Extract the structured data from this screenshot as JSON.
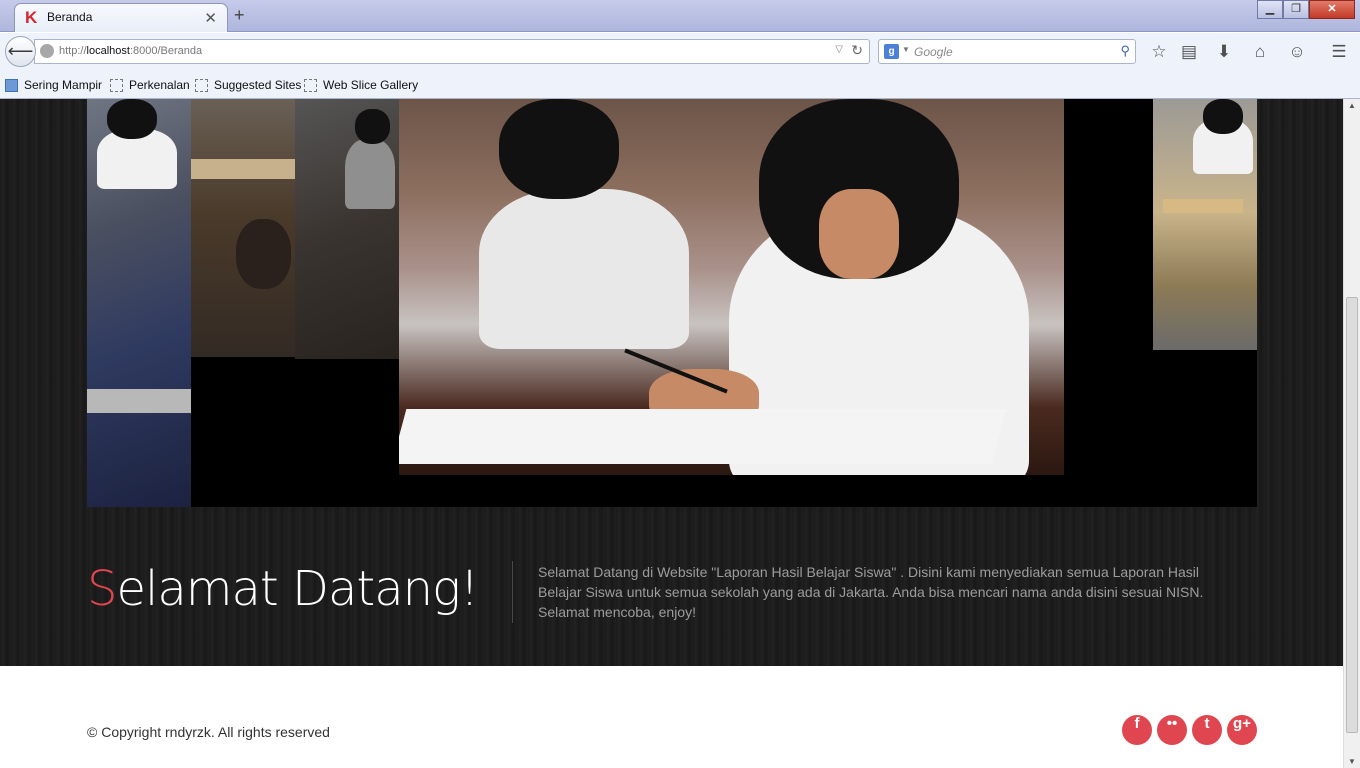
{
  "browser": {
    "tab_title": "Beranda",
    "tab_favicon": "K",
    "new_tab_symbol": "+",
    "url_scheme": "http://",
    "url_host": "localhost",
    "url_path": ":8000/Beranda",
    "search_placeholder": "Google",
    "search_engine_glyph": "g",
    "bookmarks": [
      "Sering Mampir",
      "Perkenalan",
      "Suggested Sites",
      "Web Slice Gallery"
    ]
  },
  "hero": {
    "title_first_letter": "S",
    "title_rest": "elamat Datang!",
    "intro": "Selamat Datang di Website \"Laporan Hasil Belajar Siswa\" . Disini kami menyediakan semua Laporan Hasil Belajar Siswa untuk semua sekolah yang ada di Jakarta. Anda bisa mencari nama anda disini sesuai NISN. Selamat mencoba, enjoy!"
  },
  "footer": {
    "copyright": "© Copyright rndyrzk. All rights reserved",
    "social": [
      {
        "name": "facebook-icon",
        "glyph": "f"
      },
      {
        "name": "flickr-icon",
        "glyph": "••"
      },
      {
        "name": "twitter-icon",
        "glyph": "t"
      },
      {
        "name": "google-plus-icon",
        "glyph": "g+"
      }
    ]
  },
  "colors": {
    "accent": "#e0464f",
    "dark_bg": "#1b1b1b",
    "intro_text": "#9c9c9c"
  }
}
